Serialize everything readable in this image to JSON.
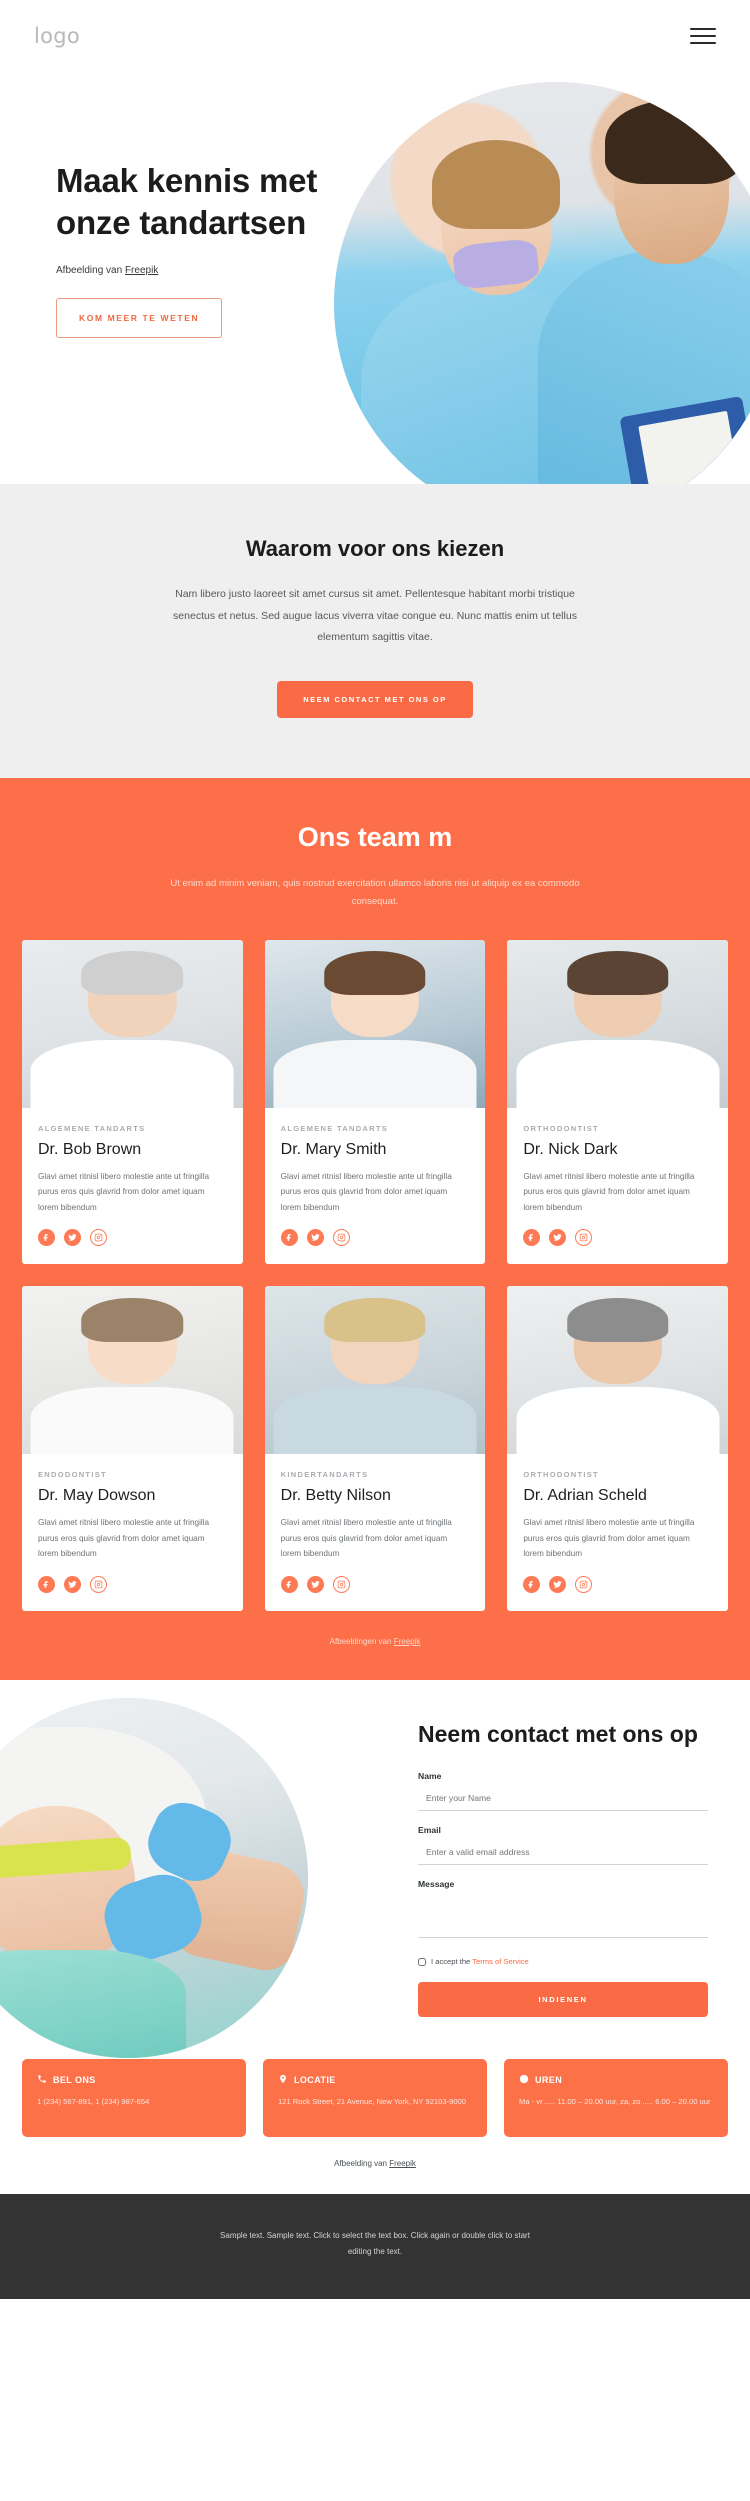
{
  "header": {
    "logo": "logo",
    "menu_icon": "hamburger-menu-icon"
  },
  "hero": {
    "title": "Maak kennis met onze tandartsen",
    "credit_prefix": "Afbeelding van ",
    "credit_link": "Freepik",
    "cta": "KOM MEER TE WETEN"
  },
  "why": {
    "title": "Waarom voor ons kiezen",
    "paragraph": "Nam libero justo laoreet sit amet cursus sit amet. Pellentesque habitant morbi tristique senectus et netus. Sed augue lacus viverra vitae congue eu. Nunc mattis enim ut tellus elementum sagittis vitae.",
    "cta": "NEEM CONTACT MET ONS OP"
  },
  "team": {
    "title": "Ons team m",
    "subtitle": "Ut enim ad minim veniam, quis nostrud exercitation ullamco laboris nisi ut aliquip ex ea commodo consequat.",
    "credit_prefix": "Afbeeldingen van ",
    "credit_link": "Freepik",
    "body_text": "Glavi amet ritnisl libero molestie ante ut fringilla purus eros quis glavrid from dolor amet iquam lorem bibendum",
    "members": [
      {
        "role": "ALGEMENE TANDARTS",
        "name": "Dr. Bob Brown"
      },
      {
        "role": "ALGEMENE TANDARTS",
        "name": "Dr. Mary Smith"
      },
      {
        "role": "ORTHODONTIST",
        "name": "Dr. Nick Dark"
      },
      {
        "role": "ENDODONTIST",
        "name": "Dr. May Dowson"
      },
      {
        "role": "KINDERTANDARTS",
        "name": "Dr. Betty Nilson"
      },
      {
        "role": "ORTHODONTIST",
        "name": "Dr. Adrian Scheld"
      }
    ],
    "social_names": [
      "facebook-icon",
      "twitter-icon",
      "instagram-icon"
    ]
  },
  "contact": {
    "title": "Neem contact met ons op",
    "fields": [
      {
        "label": "Name",
        "placeholder": "Enter your Name",
        "value": ""
      },
      {
        "label": "Email",
        "placeholder": "Enter a valid email address",
        "value": ""
      },
      {
        "label": "Message",
        "placeholder": "",
        "value": ""
      }
    ],
    "accept_prefix": "I accept the ",
    "accept_link": "Terms of Service",
    "submit": "INDIENEN"
  },
  "info_cards": [
    {
      "icon": "phone-icon",
      "title": "BEL ONS",
      "text": "1 (234) 567-891, 1 (234) 987-654"
    },
    {
      "icon": "location-pin-icon",
      "title": "LOCATIE",
      "text": "121 Rock Street, 21 Avenue, New York, NY 92103-9000"
    },
    {
      "icon": "clock-icon",
      "title": "UREN",
      "text": "Ma - vr ..... 11.00 – 20.00 uur, za, zo ..... 6.00 – 20.00 uur"
    }
  ],
  "bottom_credit": {
    "prefix": "Afbeelding van ",
    "link": "Freepik"
  },
  "footer": {
    "text": "Sample text. Sample text. Click to select the text box. Click again or double click to start editing the text."
  },
  "colors": {
    "accent": "#fd6f48",
    "accent_dark": "#fa6a44",
    "footer_bg": "#333333",
    "why_bg": "#f0efef"
  }
}
